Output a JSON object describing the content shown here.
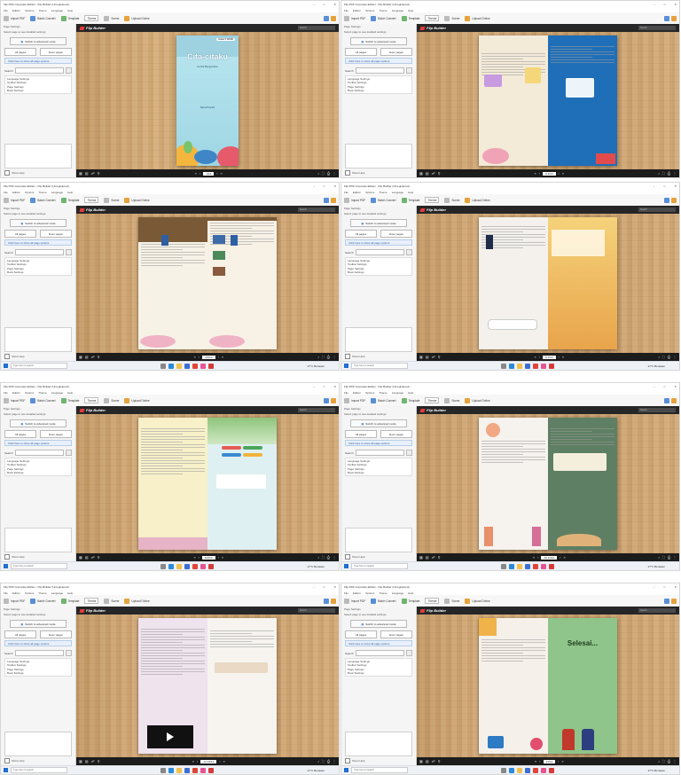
{
  "app": {
    "window_title": "Flip PDF Corporate Edition - Flip Builder (Unregistered) -",
    "menu": [
      "File",
      "Edition",
      "Options",
      "Theme",
      "Language",
      "Help"
    ],
    "ribbon": {
      "import": "Import PDF",
      "bulk": "Batch Convert",
      "template": "Template",
      "theme": "Theme",
      "scene": "Scene",
      "toolbar": "Toolbar",
      "upload": "Upload Online",
      "publish": "Publish"
    },
    "sidebar": {
      "header": "Page Settings",
      "subheader": "Select page to see detailed settings",
      "switch": "Switch to advanced mode",
      "pages": [
        "All pages",
        "Even pages"
      ],
      "tip": "Click here to show all page options",
      "search_label": "Search",
      "tree": [
        "Language Settings",
        "Toolbar Settings",
        "Page Settings",
        "Book Settings"
      ],
      "preview_label": "Preview",
      "status": "Show Help"
    },
    "viewer": {
      "logo": "Flip Builder",
      "search": "Search"
    },
    "taskbar": {
      "search": "Type here to search",
      "weather": "27°C Berawan"
    }
  },
  "book": {
    "cover_title": "Cita-citaku",
    "cover_subtitle": "Cerita Bergambar",
    "cover_badge": "Kelas 5 SD/MI",
    "cover_author": "Nama Penulis",
    "finale": "Selesai..."
  },
  "screens": [
    {
      "id": 1,
      "page": "1/14"
    },
    {
      "id": 2,
      "page": "2-3/14"
    },
    {
      "id": 3,
      "page": "4-5/14"
    },
    {
      "id": 4,
      "page": "6-7/14"
    },
    {
      "id": 5,
      "page": "8-9/14"
    },
    {
      "id": 6,
      "page": "10-11/14"
    },
    {
      "id": 7,
      "page": "12-13/14"
    },
    {
      "id": 8,
      "page": "14/14"
    }
  ],
  "colors": {
    "accent": "#1f6fd1",
    "toolbar": "#262626",
    "wood": "#c9a06d"
  }
}
